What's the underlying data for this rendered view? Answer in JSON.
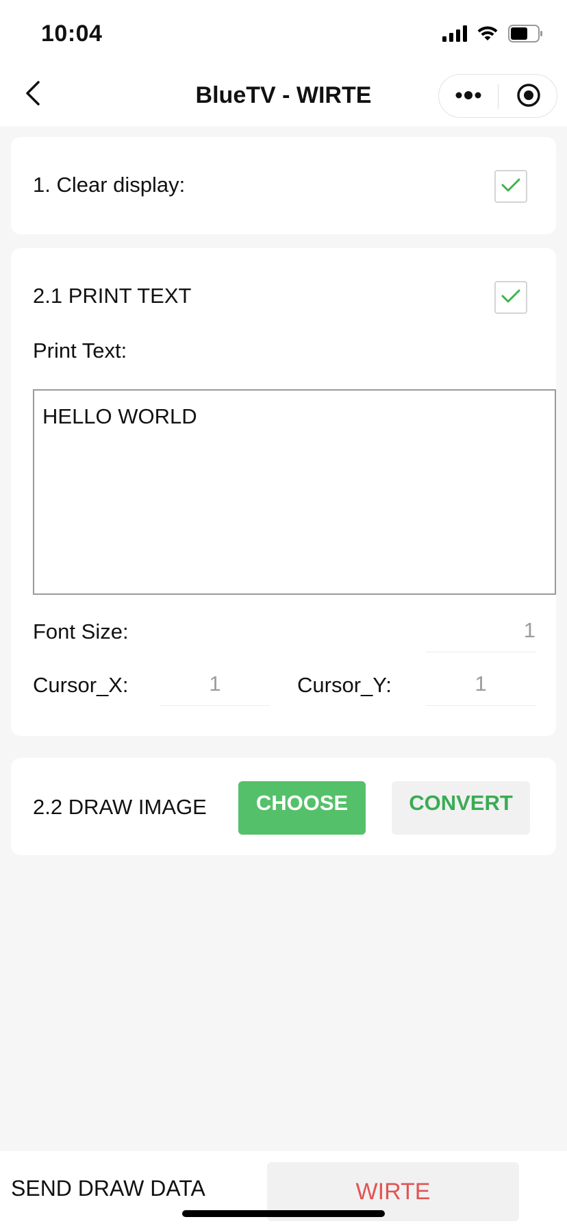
{
  "status_bar": {
    "time": "10:04",
    "icons": [
      "signal-icon",
      "wifi-icon",
      "battery-icon"
    ]
  },
  "nav": {
    "title": "BlueTV - WIRTE",
    "icons": [
      "back-chevron-icon",
      "more-dots-icon",
      "close-target-icon"
    ]
  },
  "clear_section": {
    "label": "1. Clear display:",
    "checked": true
  },
  "text_section": {
    "title": "2.1 PRINT TEXT",
    "checked": true,
    "print_text_label": "Print Text:",
    "print_text_value": "HELLO WORLD",
    "font_size_label": "Font Size:",
    "font_size_value": "1",
    "cursor_x_label": "Cursor_X:",
    "cursor_x_value": "1",
    "cursor_y_label": "Cursor_Y:",
    "cursor_y_value": "1"
  },
  "image_section": {
    "title": "2.2 DRAW IMAGE",
    "choose_label": "CHOOSE",
    "convert_label": "CONVERT"
  },
  "bottom_bar": {
    "send_label": "SEND DRAW DATA",
    "write_label": "WIRTE"
  },
  "colors": {
    "accent_green": "#55c06a",
    "convert_text_green": "#3bab54",
    "write_red": "#e05555",
    "check_green": "#3bb54a"
  }
}
